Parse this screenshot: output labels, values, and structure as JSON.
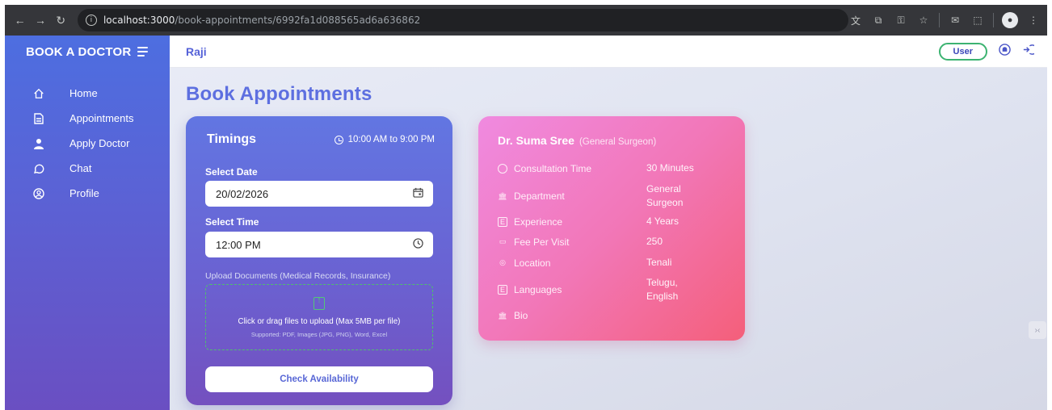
{
  "browser": {
    "url_host": "localhost:3000",
    "url_path": "/book-appointments/6992fa1d088565ad6a636862"
  },
  "sidebar": {
    "brand": "BOOK A DOCTOR",
    "items": [
      {
        "label": "Home",
        "icon": "home-icon"
      },
      {
        "label": "Appointments",
        "icon": "document-icon"
      },
      {
        "label": "Apply Doctor",
        "icon": "doctor-icon"
      },
      {
        "label": "Chat",
        "icon": "chat-icon"
      },
      {
        "label": "Profile",
        "icon": "profile-icon"
      }
    ]
  },
  "header": {
    "username": "Raji",
    "role": "User"
  },
  "page": {
    "title": "Book Appointments"
  },
  "booking": {
    "title": "Timings",
    "hours": "10:00 AM to 9:00 PM",
    "date_label": "Select Date",
    "date_value": "20/02/2026",
    "time_label": "Select Time",
    "time_value": "12:00 PM",
    "upload_label": "Upload Documents (Medical Records, Insurance)",
    "upload_text": "Click or drag files to upload (Max 5MB per file)",
    "upload_supported": "Supported: PDF, Images (JPG, PNG), Word, Excel",
    "check_button": "Check Availability"
  },
  "doctor": {
    "name": "Dr. Suma Sree",
    "specialization": "(General Surgeon)",
    "rows": [
      {
        "label": "Consultation Time",
        "value": "30 Minutes",
        "icon": "clock-icon"
      },
      {
        "label": "Department",
        "value": "General Surgeon",
        "icon": "building-icon"
      },
      {
        "label": "Experience",
        "value": "4 Years",
        "icon": "experience-icon"
      },
      {
        "label": "Fee Per Visit",
        "value": "250",
        "icon": "wallet-icon"
      },
      {
        "label": "Location",
        "value": "Tenali",
        "icon": "location-icon"
      },
      {
        "label": "Languages",
        "value": "Telugu, English",
        "icon": "language-icon"
      },
      {
        "label": "Bio",
        "value": "",
        "icon": "bio-icon"
      }
    ]
  },
  "colors": {
    "sidebar_top": "#4d6ee0",
    "sidebar_bottom": "#6a4fc2",
    "title": "#5d6fe0",
    "doctor_card_start": "#f08ae0",
    "doctor_card_end": "#f45f7a",
    "role_badge_border": "#3cb371"
  }
}
